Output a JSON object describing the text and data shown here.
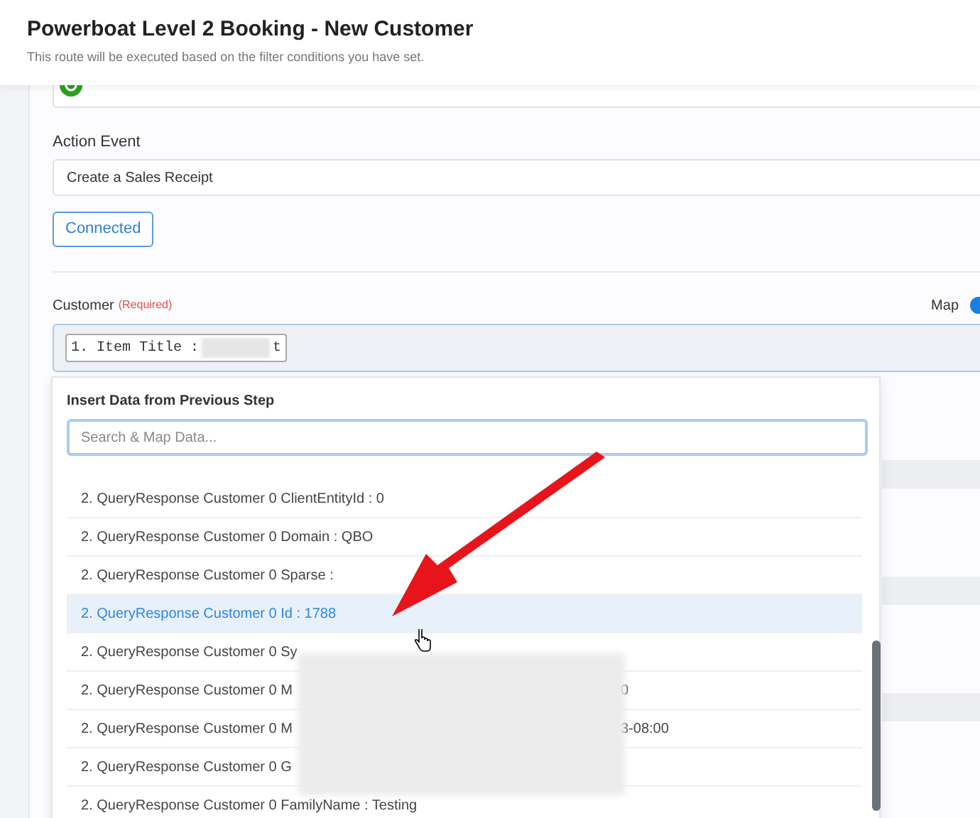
{
  "header": {
    "title": "Powerboat Level 2 Booking - New Customer",
    "subtitle": "This route will be executed based on the filter conditions you have set."
  },
  "action_event": {
    "label": "Action Event",
    "value": "Create a Sales Receipt"
  },
  "connected_button": "Connected",
  "customer": {
    "label": "Customer",
    "required": "(Required)",
    "map_label": "Map",
    "map_on": true,
    "chip_start": "1. Item Title :",
    "chip_end": "t"
  },
  "dropdown": {
    "title": "Insert Data from Previous Step",
    "search": {
      "placeholder": "Search & Map Data..."
    },
    "items": [
      {
        "text": "2. QueryResponse Customer 0 ClientEntityId : 0",
        "selected": false
      },
      {
        "text": "2. QueryResponse Customer 0 Domain : QBO",
        "selected": false
      },
      {
        "text": "2. QueryResponse Customer 0 Sparse :",
        "selected": false
      },
      {
        "text": "2. QueryResponse Customer 0 Id : 1788",
        "selected": true
      },
      {
        "text": "2. QueryResponse Customer 0 Sy",
        "selected": false
      },
      {
        "text": "2. QueryResponse Customer 0 M",
        "tail": "0",
        "selected": false
      },
      {
        "text": "2. QueryResponse Customer 0 M",
        "tail": "3-08:00",
        "selected": false
      },
      {
        "text": "2. QueryResponse Customer 0 G",
        "selected": false
      },
      {
        "text": "2. QueryResponse Customer 0 FamilyName : Testing",
        "selected": false
      }
    ]
  }
}
